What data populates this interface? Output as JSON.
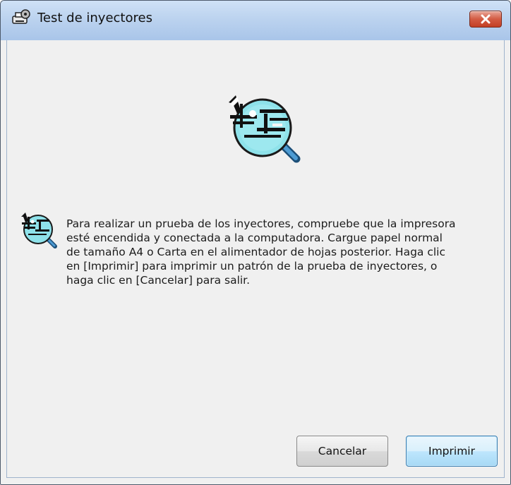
{
  "window": {
    "title": "Test de inyectores",
    "icon": "printer-gear-icon",
    "close_icon": "close-icon",
    "close_color": "#c94a30"
  },
  "content": {
    "hero_icon": "nozzle-check-magnifier-icon",
    "message_icon": "nozzle-check-magnifier-icon",
    "message": "Para realizar un prueba de los inyectores, compruebe que la impresora\nesté encendida y conectada a la computadora. Cargue papel normal\nde tamaño A4 o Carta en el alimentador de hojas posterior. Haga clic\nen [Imprimir] para imprimir un patrón de la prueba de inyectores, o\nhaga clic en [Cancelar] para salir."
  },
  "buttons": {
    "cancel": "Cancelar",
    "print": "Imprimir"
  }
}
